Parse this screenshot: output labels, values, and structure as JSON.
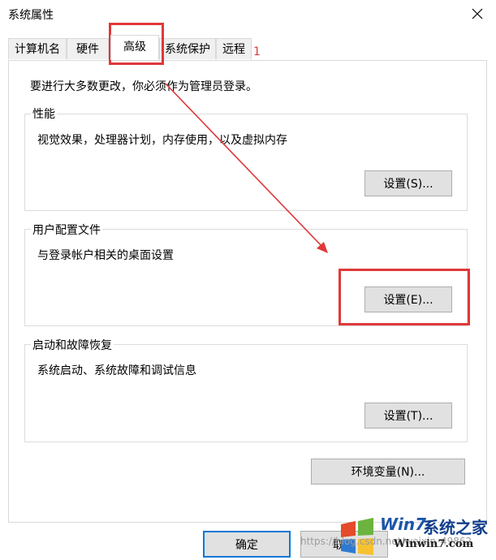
{
  "window": {
    "title": "系统属性"
  },
  "tabs": [
    {
      "label": "计算机名"
    },
    {
      "label": "硬件"
    },
    {
      "label": "高级"
    },
    {
      "label": "系统保护"
    },
    {
      "label": "远程"
    }
  ],
  "notice": "要进行大多数更改，你必须作为管理员登录。",
  "performance": {
    "title": "性能",
    "desc": "视觉效果，处理器计划，内存使用，以及虚拟内存",
    "button": "设置(S)..."
  },
  "profiles": {
    "title": "用户配置文件",
    "desc": "与登录帐户相关的桌面设置",
    "button": "设置(E)..."
  },
  "startup": {
    "title": "启动和故障恢复",
    "desc": "系统启动、系统故障和调试信息",
    "button": "设置(T)..."
  },
  "env_button": "环境变量(N)...",
  "footer": {
    "ok": "确定",
    "cancel": "取消"
  },
  "annotation": {
    "number": "1",
    "color": "#e0383a"
  },
  "watermark": {
    "brand": "Win7",
    "brand_cn": "系统之家",
    "url": "Winwin7.com",
    "blog": "https://blog.csdn.net/weixin_49862"
  }
}
